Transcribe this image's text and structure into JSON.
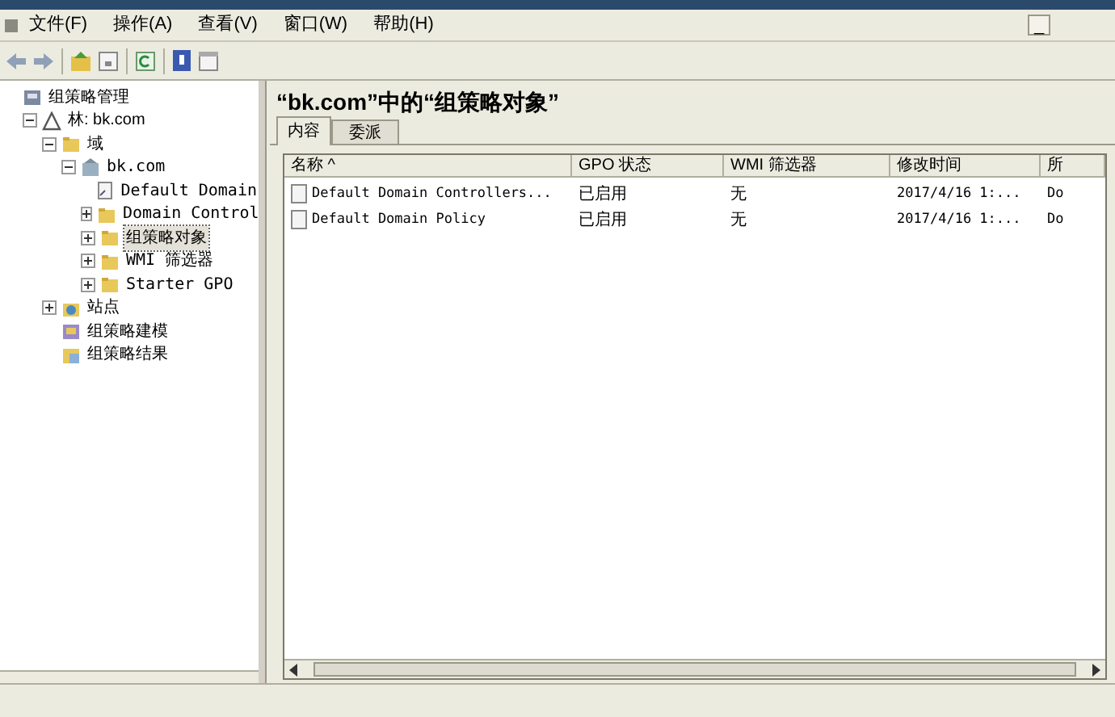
{
  "menu": [
    "文件(F)",
    "操作(A)",
    "查看(V)",
    "窗口(W)",
    "帮助(H)"
  ],
  "window_controls": [
    "_"
  ],
  "tree": [
    {
      "label": "组策略管理",
      "kind": "root",
      "selected": false,
      "children": [
        {
          "label": "林: bk.com",
          "kind": "forest",
          "selected": false,
          "expanded": true,
          "children": [
            {
              "label": "域",
              "kind": "folder",
              "selected": false,
              "expanded": true,
              "children": [
                {
                  "label": "bk.com",
                  "kind": "domain",
                  "selected": false,
                  "expanded": true,
                  "children": [
                    {
                      "label": "Default Domain",
                      "kind": "gpo",
                      "selected": false
                    },
                    {
                      "label": "Domain Control",
                      "kind": "folder",
                      "selected": false,
                      "expanded": false
                    },
                    {
                      "label": "组策略对象",
                      "kind": "folder",
                      "selected": true,
                      "expanded": false
                    },
                    {
                      "label": "WMI 筛选器",
                      "kind": "folder",
                      "selected": false,
                      "expanded": false
                    },
                    {
                      "label": "Starter GPO",
                      "kind": "folder",
                      "selected": false,
                      "expanded": false
                    }
                  ]
                }
              ]
            },
            {
              "label": "站点",
              "kind": "sites",
              "selected": false,
              "expanded": false
            },
            {
              "label": "组策略建模",
              "kind": "modeling",
              "selected": false
            },
            {
              "label": "组策略结果",
              "kind": "results",
              "selected": false
            }
          ]
        }
      ]
    }
  ],
  "pane_title": "“bk.com”中的“组策略对象”",
  "tabs": [
    {
      "label": "内容",
      "selected": true
    },
    {
      "label": "委派",
      "selected": false
    }
  ],
  "table": {
    "columns": [
      "名称 ^",
      "GPO 状态",
      "WMI 筛选器",
      "修改时间",
      "所"
    ],
    "rows": [
      [
        "Default Domain Controllers...",
        "已启用",
        "无",
        "2017/4/16 1:...",
        "Do"
      ],
      [
        "Default Domain Policy",
        "已启用",
        "无",
        "2017/4/16 1:...",
        "Do"
      ]
    ]
  }
}
